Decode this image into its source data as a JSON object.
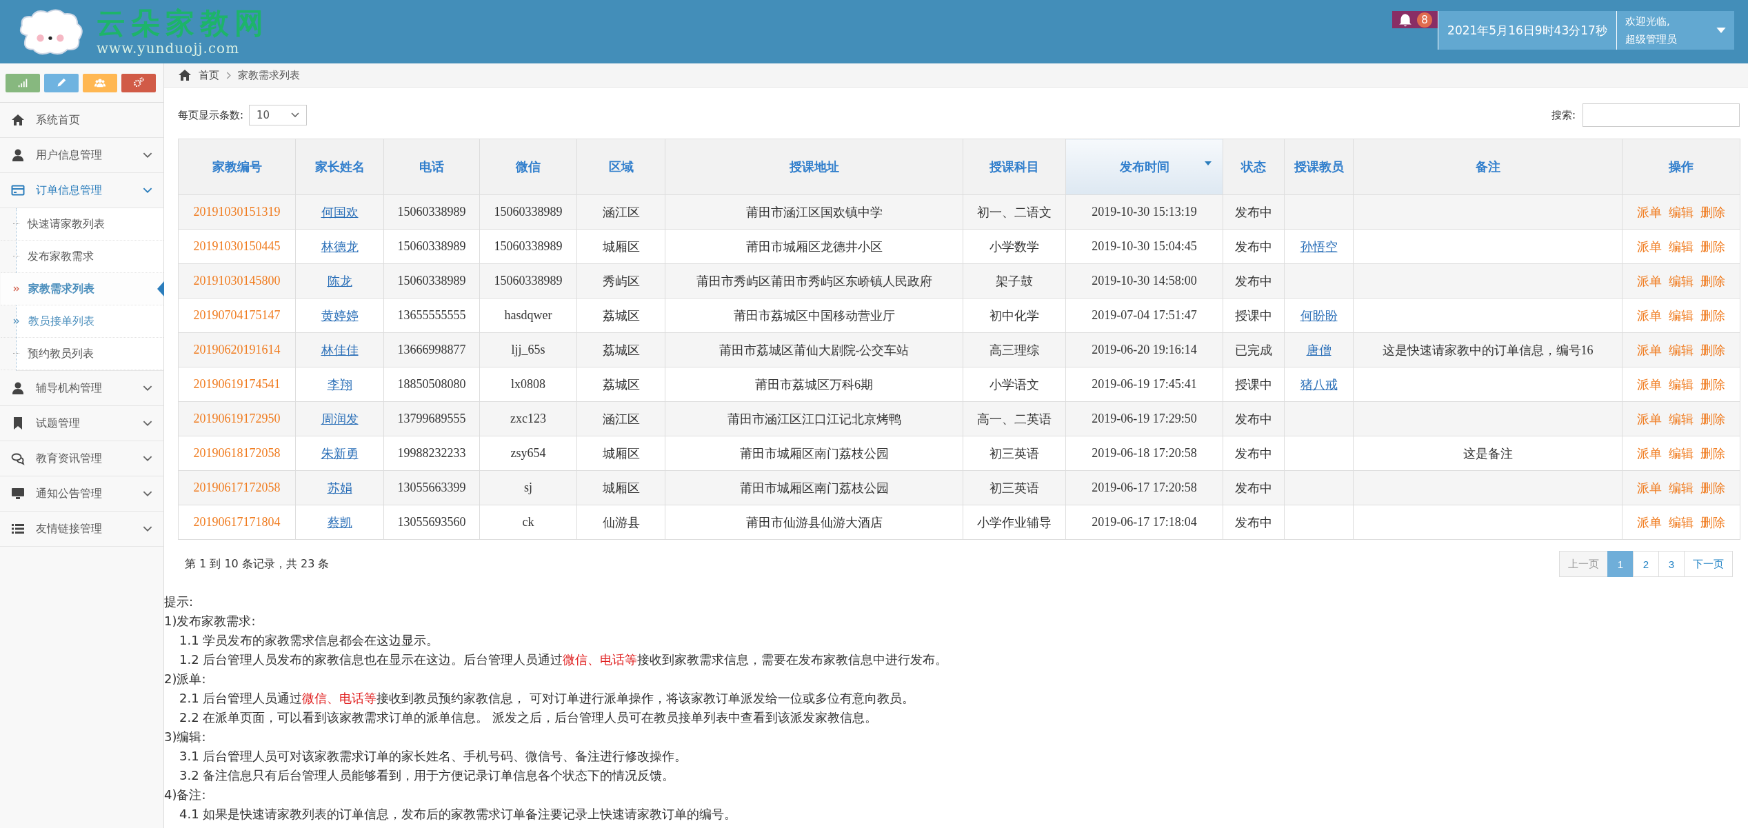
{
  "header": {
    "logo_title": "云朵家教网",
    "logo_url": "www.yunduojj.com",
    "notification_count": "8",
    "datetime": "2021年5月16日9时43分17秒",
    "welcome": "欢迎光临,",
    "user": "超级管理员"
  },
  "toolbar_buttons": [
    {
      "color": "#87b87f"
    },
    {
      "color": "#6fb3e0"
    },
    {
      "color": "#ffb752"
    },
    {
      "color": "#d15b47"
    }
  ],
  "sidebar": {
    "items": [
      {
        "label": "系统首页",
        "expanded": false,
        "has_arrow": false
      },
      {
        "label": "用户信息管理",
        "expanded": false,
        "has_arrow": true
      },
      {
        "label": "订单信息管理",
        "expanded": true,
        "has_arrow": true,
        "children": [
          {
            "label": "快速请家教列表",
            "selected": false,
            "highlighted": false
          },
          {
            "label": "发布家教需求",
            "selected": false,
            "highlighted": false
          },
          {
            "label": "家教需求列表",
            "selected": true,
            "highlighted": false
          },
          {
            "label": "教员接单列表",
            "selected": false,
            "highlighted": true
          },
          {
            "label": "预约教员列表",
            "selected": false,
            "highlighted": false
          }
        ]
      },
      {
        "label": "辅导机构管理",
        "expanded": false,
        "has_arrow": true
      },
      {
        "label": "试题管理",
        "expanded": false,
        "has_arrow": true
      },
      {
        "label": "教育资讯管理",
        "expanded": false,
        "has_arrow": true
      },
      {
        "label": "通知公告管理",
        "expanded": false,
        "has_arrow": true
      },
      {
        "label": "友情链接管理",
        "expanded": false,
        "has_arrow": true
      }
    ]
  },
  "breadcrumb": [
    "首页",
    "家教需求列表"
  ],
  "page_size": {
    "label": "每页显示条数:",
    "value": "10"
  },
  "search": {
    "label": "搜索:"
  },
  "table": {
    "columns": [
      {
        "label": "家教编号",
        "sorted": false
      },
      {
        "label": "家长姓名",
        "sorted": false
      },
      {
        "label": "电话",
        "sorted": false
      },
      {
        "label": "微信",
        "sorted": false
      },
      {
        "label": "区域",
        "sorted": false
      },
      {
        "label": "授课地址",
        "sorted": false
      },
      {
        "label": "授课科目",
        "sorted": false
      },
      {
        "label": "发布时间",
        "sorted": true
      },
      {
        "label": "状态",
        "sorted": false
      },
      {
        "label": "授课教员",
        "sorted": false
      },
      {
        "label": "备注",
        "sorted": false
      },
      {
        "label": "操作",
        "sorted": false
      }
    ],
    "rows": [
      {
        "id": "20191030151319",
        "parent": "何国欢",
        "phone": "15060338989",
        "wechat": "15060338989",
        "area": "涵江区",
        "address": "莆田市涵江区国欢镇中学",
        "subject": "初一、二语文",
        "time": "2019-10-30 15:13:19",
        "status": "发布中",
        "teacher": "",
        "note": "",
        "actions": [
          "派单",
          "编辑",
          "删除"
        ]
      },
      {
        "id": "20191030150445",
        "parent": "林德龙",
        "phone": "15060338989",
        "wechat": "15060338989",
        "area": "城厢区",
        "address": "莆田市城厢区龙德井小区",
        "subject": "小学数学",
        "time": "2019-10-30 15:04:45",
        "status": "发布中",
        "teacher": "孙悟空",
        "note": "",
        "actions": [
          "派单",
          "编辑",
          "删除"
        ]
      },
      {
        "id": "20191030145800",
        "parent": "陈龙",
        "phone": "15060338989",
        "wechat": "15060338989",
        "area": "秀屿区",
        "address": "莆田市秀屿区莆田市秀屿区东峤镇人民政府",
        "subject": "架子鼓",
        "time": "2019-10-30 14:58:00",
        "status": "发布中",
        "teacher": "",
        "note": "",
        "actions": [
          "派单",
          "编辑",
          "删除"
        ]
      },
      {
        "id": "20190704175147",
        "parent": "黄婷婷",
        "phone": "13655555555",
        "wechat": "hasdqwer",
        "area": "荔城区",
        "address": "莆田市荔城区中国移动营业厅",
        "subject": "初中化学",
        "time": "2019-07-04 17:51:47",
        "status": "授课中",
        "teacher": "何盼盼",
        "note": "",
        "actions": [
          "派单",
          "编辑",
          "删除"
        ]
      },
      {
        "id": "20190620191614",
        "parent": "林佳佳",
        "phone": "13666998877",
        "wechat": "ljj_65s",
        "area": "荔城区",
        "address": "莆田市荔城区莆仙大剧院-公交车站",
        "subject": "高三理综",
        "time": "2019-06-20 19:16:14",
        "status": "已完成",
        "teacher": "唐僧",
        "note": "这是快速请家教中的订单信息，编号16",
        "actions": [
          "派单",
          "编辑",
          "删除"
        ]
      },
      {
        "id": "20190619174541",
        "parent": "李翔",
        "phone": "18850508080",
        "wechat": "lx0808",
        "area": "荔城区",
        "address": "莆田市荔城区万科6期",
        "subject": "小学语文",
        "time": "2019-06-19 17:45:41",
        "status": "授课中",
        "teacher": "猪八戒",
        "note": "",
        "actions": [
          "派单",
          "编辑",
          "删除"
        ]
      },
      {
        "id": "20190619172950",
        "parent": "周润发",
        "phone": "13799689555",
        "wechat": "zxc123",
        "area": "涵江区",
        "address": "莆田市涵江区江口江记北京烤鸭",
        "subject": "高一、二英语",
        "time": "2019-06-19 17:29:50",
        "status": "发布中",
        "teacher": "",
        "note": "",
        "actions": [
          "派单",
          "编辑",
          "删除"
        ]
      },
      {
        "id": "20190618172058",
        "parent": "朱新勇",
        "phone": "19988232233",
        "wechat": "zsy654",
        "area": "城厢区",
        "address": "莆田市城厢区南门荔枝公园",
        "subject": "初三英语",
        "time": "2019-06-18 17:20:58",
        "status": "发布中",
        "teacher": "",
        "note": "这是备注",
        "actions": [
          "派单",
          "编辑",
          "删除"
        ]
      },
      {
        "id": "20190617172058",
        "parent": "苏娟",
        "phone": "13055663399",
        "wechat": "sj",
        "area": "城厢区",
        "address": "莆田市城厢区南门荔枝公园",
        "subject": "初三英语",
        "time": "2019-06-17 17:20:58",
        "status": "发布中",
        "teacher": "",
        "note": "",
        "actions": [
          "派单",
          "编辑",
          "删除"
        ]
      },
      {
        "id": "20190617171804",
        "parent": "蔡凯",
        "phone": "13055693560",
        "wechat": "ck",
        "area": "仙游县",
        "address": "莆田市仙游县仙游大酒店",
        "subject": "小学作业辅导",
        "time": "2019-06-17 17:18:04",
        "status": "发布中",
        "teacher": "",
        "note": "",
        "actions": [
          "派单",
          "编辑",
          "删除"
        ]
      }
    ]
  },
  "record_info": "第 1 到 10 条记录，共 23 条",
  "pagination": [
    {
      "label": "上一页",
      "selected": false,
      "disabled": true
    },
    {
      "label": "1",
      "selected": true,
      "disabled": false
    },
    {
      "label": "2",
      "selected": false,
      "disabled": false
    },
    {
      "label": "3",
      "selected": false,
      "disabled": false
    },
    {
      "label": "下一页",
      "selected": false,
      "disabled": false
    }
  ],
  "notes": [
    {
      "kind": "heading",
      "parts": [
        {
          "text": "提示:",
          "highlight": false
        }
      ]
    },
    {
      "kind": "heading",
      "parts": [
        {
          "text": "1)发布家教需求:",
          "highlight": false
        }
      ]
    },
    {
      "kind": "item",
      "parts": [
        {
          "text": "1.1 学员发布的家教需求信息都会在这边显示。",
          "highlight": false
        }
      ]
    },
    {
      "kind": "item",
      "parts": [
        {
          "text": "1.2 后台管理人员发布的家教信息也在显示在这边。后台管理人员通过",
          "highlight": false
        },
        {
          "text": "微信、电话等",
          "highlight": true
        },
        {
          "text": "接收到家教需求信息，需要在发布家教信息中进行发布。",
          "highlight": false
        }
      ]
    },
    {
      "kind": "heading",
      "parts": [
        {
          "text": "2)派单:",
          "highlight": false
        }
      ]
    },
    {
      "kind": "item",
      "parts": [
        {
          "text": "2.1 后台管理人员通过",
          "highlight": false
        },
        {
          "text": "微信、电话等",
          "highlight": true
        },
        {
          "text": "接收到教员预约家教信息， 可对订单进行派单操作，将该家教订单派发给一位或多位有意向教员。",
          "highlight": false
        }
      ]
    },
    {
      "kind": "item",
      "parts": [
        {
          "text": "2.2 在派单页面，可以看到该家教需求订单的派单信息。 派发之后，后台管理人员可在教员接单列表中查看到该派发家教信息。",
          "highlight": false
        }
      ]
    },
    {
      "kind": "heading",
      "parts": [
        {
          "text": "3)编辑:",
          "highlight": false
        }
      ]
    },
    {
      "kind": "item",
      "parts": [
        {
          "text": "3.1 后台管理人员可对该家教需求订单的家长姓名、手机号码、微信号、备注进行修改操作。",
          "highlight": false
        }
      ]
    },
    {
      "kind": "item",
      "parts": [
        {
          "text": "3.2 备注信息只有后台管理人员能够看到，用于方便记录订单信息各个状态下的情况反馈。",
          "highlight": false
        }
      ]
    },
    {
      "kind": "heading",
      "parts": [
        {
          "text": "4)备注:",
          "highlight": false
        }
      ]
    },
    {
      "kind": "item",
      "parts": [
        {
          "text": "4.1 如果是快速请家教列表的订单信息，发布后的家教需求订单备注要记录上快速请家教订单的编号。",
          "highlight": false
        }
      ]
    }
  ]
}
